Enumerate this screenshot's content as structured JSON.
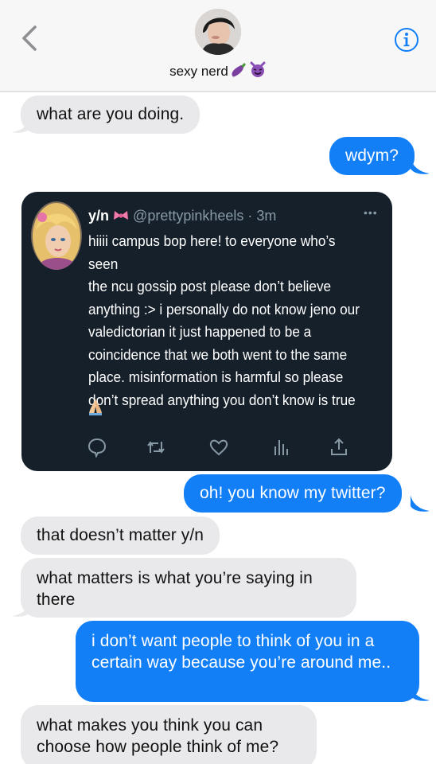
{
  "header": {
    "contact_name": "sexy nerd"
  },
  "messages": [
    {
      "side": "in",
      "text": "what are you doing."
    },
    {
      "side": "out",
      "text": "wdym?"
    },
    {
      "side": "out",
      "type": "tweet-screenshot"
    },
    {
      "side": "out",
      "text": "oh! you know my twitter?"
    },
    {
      "side": "in",
      "text": "that doesn’t matter y/n"
    },
    {
      "side": "in",
      "text": "what matters is what you’re saying in there"
    },
    {
      "side": "out",
      "text": "i don’t want people to think of you in a certain way because you’re around me.."
    },
    {
      "side": "in",
      "text": "what makes you think you can choose how people think of me?"
    }
  ],
  "tweet": {
    "name": "y/n",
    "handle": "@prettypinkheels · 3m",
    "body": "hiiii campus bop here! to everyone who’s seen\nthe ncu gossip post please don’t believe\nanything :> i personally do not know jeno our\nvaledictorian it just happened to be a\ncoincidence that we both went to the same\nplace. misinformation is harmful so please\ndon’t spread anything you don’t know is true",
    "more": "•••"
  },
  "colors": {
    "outgoing": "#127ff6",
    "incoming": "#e9e9eb",
    "tweet_bg": "#15202b",
    "header_bg": "#f7f7f7",
    "accent": "#127ff6"
  },
  "icons": [
    "back-chevron-icon",
    "info-icon",
    "eggplant-icon",
    "devil-icon",
    "ribbon-icon",
    "folded-hands-icon",
    "reply-icon",
    "retweet-icon",
    "like-icon",
    "analytics-icon",
    "share-icon"
  ]
}
